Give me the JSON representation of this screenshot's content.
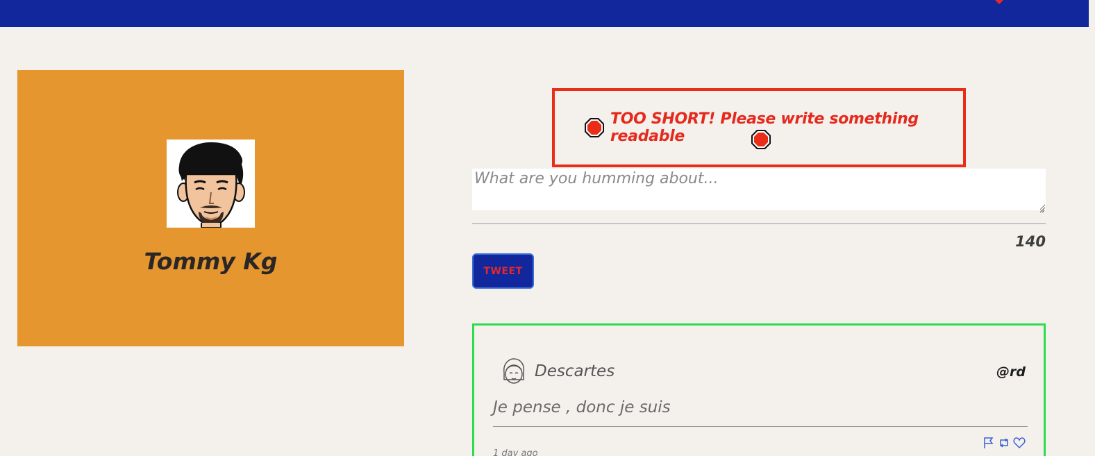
{
  "header": {
    "accent_color": "#13279c",
    "mark_color": "#e8262a"
  },
  "profile": {
    "name": "Tommy Kg",
    "avatar_icon": "cartoon-man-avatar",
    "card_color": "#e5962f"
  },
  "composer": {
    "error_message": "TOO SHORT! Please write something readable",
    "error_icon": "stop-sign-icon",
    "error_color": "#ea2d18",
    "placeholder": "What are you humming about...",
    "value": "",
    "char_counter": "140",
    "tweet_button_label": "TWEET"
  },
  "feed": {
    "border_color": "#2bdc4c",
    "tweets": [
      {
        "author": "Descartes",
        "handle": "@rd",
        "content": "Je pense , donc je suis",
        "timestamp": "1 day ago",
        "avatar_icon": "girl-face-icon",
        "actions": [
          "flag-icon",
          "retweet-icon",
          "heart-icon"
        ]
      }
    ]
  }
}
